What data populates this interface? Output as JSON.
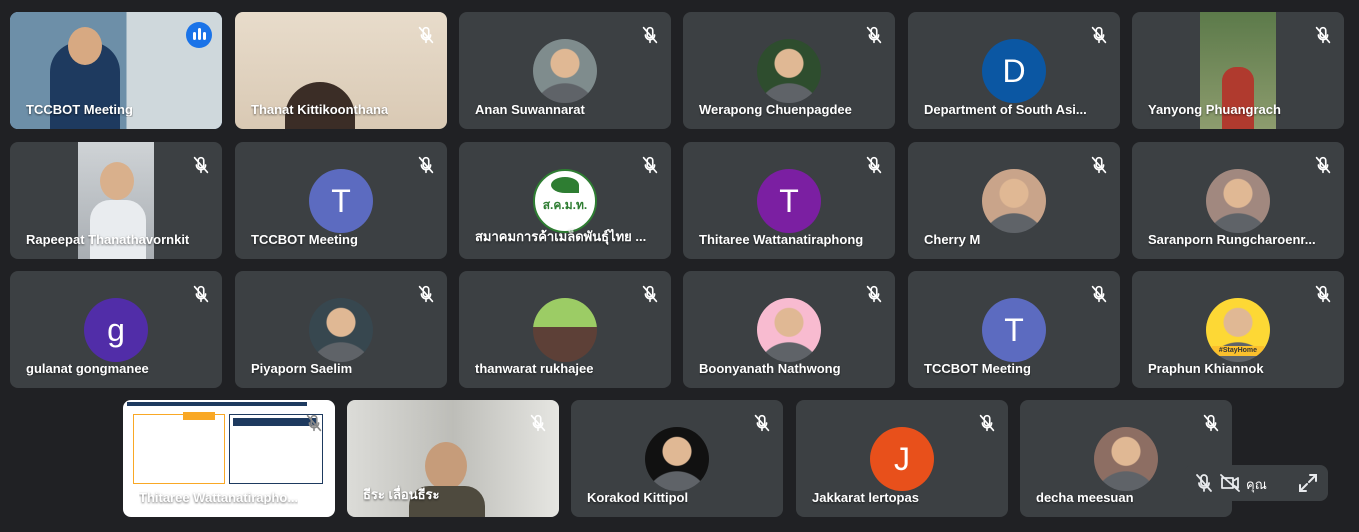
{
  "participants": [
    {
      "name": "TCCBOT Meeting"
    },
    {
      "name": "Thanat Kittikoonthana"
    },
    {
      "name": "Anan Suwannarat"
    },
    {
      "name": "Werapong Chuenpagdee"
    },
    {
      "name": "Department of South Asi...",
      "initial": "D"
    },
    {
      "name": "Yanyong Phuangrach"
    },
    {
      "name": "Rapeepat Thanathavornkit"
    },
    {
      "name": "TCCBOT Meeting",
      "initial": "T"
    },
    {
      "name": "สมาคมการค้าเมล็ดพันธุ์ไทย ...",
      "logo_text": "ส.ค.ม.ท."
    },
    {
      "name": "Thitaree Wattanatiraphong",
      "initial": "T"
    },
    {
      "name": "Cherry M"
    },
    {
      "name": "Saranporn Rungcharoenr..."
    },
    {
      "name": "gulanat gongmanee",
      "initial": "g"
    },
    {
      "name": "Piyaporn Saelim"
    },
    {
      "name": "thanwarat rukhajee"
    },
    {
      "name": "Boonyanath Nathwong"
    },
    {
      "name": "TCCBOT Meeting",
      "initial": "T"
    },
    {
      "name": "Praphun Khiannok",
      "badge": "#StayHome"
    },
    {
      "name": "Thitaree Wattanatiraphо..."
    },
    {
      "name": "ธีระ เลื่อนธีระ"
    },
    {
      "name": "Korakod Kittipol"
    },
    {
      "name": "Jakkarat lertopas",
      "initial": "J"
    },
    {
      "name": "decha meesuan"
    }
  ],
  "controls": {
    "label": "คุณ"
  },
  "colors": {
    "accent": "#8ab4f8",
    "speaking": "#1a73e8"
  }
}
